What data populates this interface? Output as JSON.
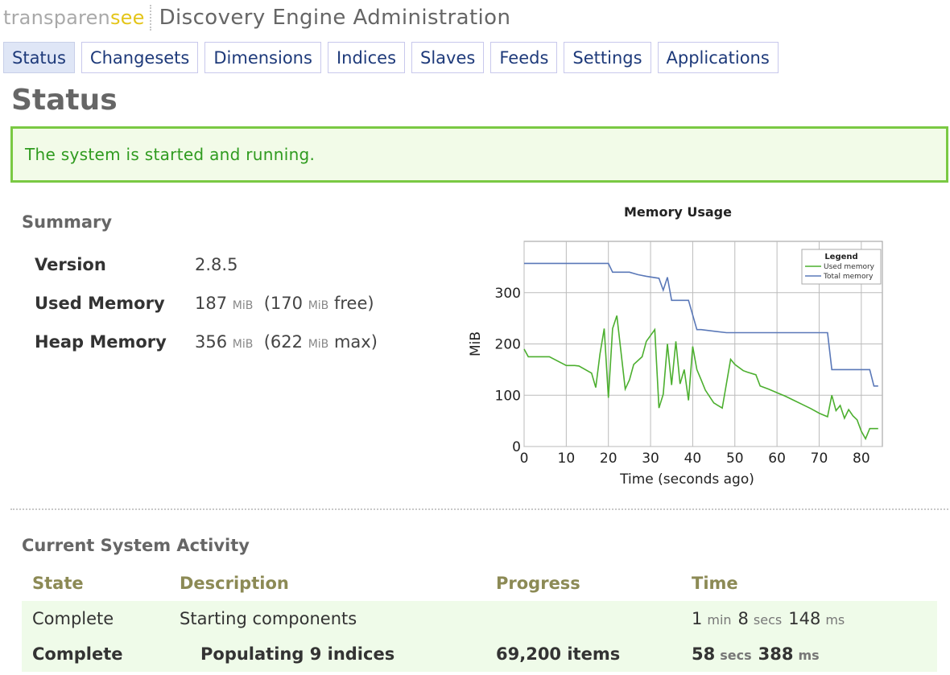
{
  "header": {
    "logo_part1": "transparen",
    "logo_part2": "see",
    "app_title": "Discovery Engine Administration"
  },
  "tabs": [
    {
      "label": "Status",
      "active": true
    },
    {
      "label": "Changesets",
      "active": false
    },
    {
      "label": "Dimensions",
      "active": false
    },
    {
      "label": "Indices",
      "active": false
    },
    {
      "label": "Slaves",
      "active": false
    },
    {
      "label": "Feeds",
      "active": false
    },
    {
      "label": "Settings",
      "active": false
    },
    {
      "label": "Applications",
      "active": false
    }
  ],
  "page_title": "Status",
  "status_message": "The system is started and running.",
  "summary": {
    "title": "Summary",
    "version_label": "Version",
    "version_value": "2.8.5",
    "used_memory_label": "Used Memory",
    "used_memory_value": "187",
    "used_memory_free_value": "170",
    "used_memory_suffix": "free)",
    "heap_memory_label": "Heap Memory",
    "heap_memory_value": "356",
    "heap_memory_max_value": "622",
    "heap_memory_suffix": "max)",
    "unit": "MiB",
    "open_paren": "("
  },
  "chart_data": {
    "type": "line",
    "title": "Memory Usage",
    "xlabel": "Time (seconds ago)",
    "ylabel": "MiB",
    "xlim": [
      0,
      85
    ],
    "ylim": [
      0,
      400
    ],
    "xticks": [
      0,
      10,
      20,
      30,
      40,
      50,
      60,
      70,
      80
    ],
    "yticks": [
      0,
      100,
      200,
      300
    ],
    "grid": true,
    "legend_title": "Legend",
    "legend_position": "top-right",
    "series": [
      {
        "name": "Used memory",
        "color": "#4caf2f",
        "x": [
          0,
          1,
          5,
          6,
          10,
          12,
          13,
          16,
          17,
          18,
          19,
          20,
          21,
          22,
          24,
          25,
          26,
          28,
          29,
          31,
          32,
          33,
          34,
          35,
          36,
          37,
          38,
          39,
          40,
          41,
          42,
          43,
          45,
          47,
          49,
          50,
          52,
          53,
          55,
          56,
          58,
          60,
          62,
          64,
          66,
          68,
          70,
          72,
          73,
          74,
          75,
          76,
          77,
          78,
          79,
          80,
          81,
          82,
          83,
          84
        ],
        "y": [
          190,
          175,
          175,
          175,
          158,
          158,
          157,
          143,
          115,
          180,
          230,
          95,
          230,
          255,
          112,
          130,
          160,
          175,
          205,
          228,
          75,
          102,
          200,
          120,
          205,
          122,
          150,
          90,
          195,
          150,
          130,
          110,
          85,
          75,
          170,
          160,
          148,
          145,
          140,
          118,
          112,
          105,
          98,
          90,
          82,
          74,
          65,
          58,
          100,
          70,
          80,
          55,
          72,
          60,
          52,
          30,
          15,
          35,
          35,
          35
        ]
      },
      {
        "name": "Total memory",
        "color": "#5a78b8",
        "x": [
          0,
          20,
          21,
          25,
          27,
          29,
          32,
          33,
          34,
          35,
          36,
          37,
          39,
          41,
          42,
          48,
          50,
          72,
          73,
          80,
          82,
          83,
          84
        ],
        "y": [
          357,
          357,
          340,
          340,
          335,
          332,
          328,
          305,
          330,
          285,
          285,
          285,
          285,
          228,
          228,
          222,
          222,
          222,
          150,
          150,
          150,
          118,
          118
        ]
      }
    ]
  },
  "activity": {
    "title": "Current System Activity",
    "headers": [
      "State",
      "Description",
      "Progress",
      "Time"
    ],
    "rows": [
      {
        "state": "Complete",
        "description": "Starting components",
        "progress": "",
        "t1": "1",
        "u1": "min",
        "t2": "8",
        "u2": "secs",
        "t3": "148",
        "u3": "ms"
      },
      {
        "state": "Complete",
        "description": "Populating 9 indices",
        "progress": "69,200 items",
        "t1": "58",
        "u1": "secs",
        "t2": "388",
        "u2": "ms"
      }
    ]
  }
}
